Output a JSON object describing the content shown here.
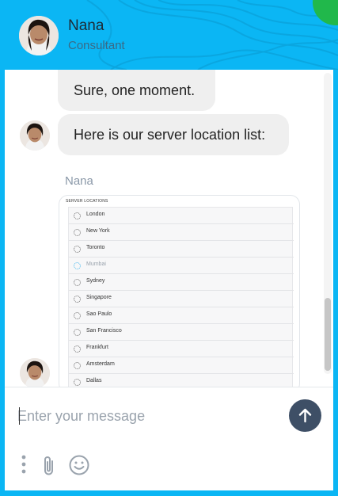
{
  "header": {
    "agent_name": "Nana",
    "agent_role": "Consultant",
    "accent_color": "#0bb6f4",
    "status_color": "#21b84b"
  },
  "messages": [
    {
      "text": "Sure, one moment."
    },
    {
      "text": "Here is our server location list:"
    }
  ],
  "attachment": {
    "sender": "Nana",
    "title": "SERVER LOCATIONS",
    "locations": [
      {
        "name": "London",
        "active": false
      },
      {
        "name": "New York",
        "active": false
      },
      {
        "name": "Toronto",
        "active": false
      },
      {
        "name": "Mumbai",
        "active": true
      },
      {
        "name": "Sydney",
        "active": false
      },
      {
        "name": "Singapore",
        "active": false
      },
      {
        "name": "Sao Paulo",
        "active": false
      },
      {
        "name": "San Francisco",
        "active": false
      },
      {
        "name": "Frankfurt",
        "active": false
      },
      {
        "name": "Amsterdam",
        "active": false
      },
      {
        "name": "Dallas",
        "active": false
      }
    ]
  },
  "composer": {
    "placeholder": "Enter your message",
    "send_icon": "arrow-up-icon",
    "tools": [
      "more-vertical-icon",
      "paperclip-icon",
      "smiley-icon"
    ]
  }
}
